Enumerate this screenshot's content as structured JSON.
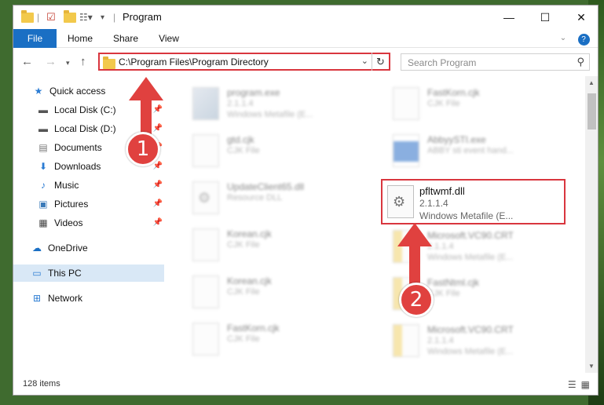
{
  "window": {
    "title": "Program",
    "controls": {
      "minimize": "—",
      "maximize": "☐",
      "close": "✕"
    }
  },
  "ribbon": {
    "tabs": [
      "File",
      "Home",
      "Share",
      "View"
    ],
    "help": "?"
  },
  "address": {
    "path": "C:\\Program Files\\Program Directory",
    "search_placeholder": "Search Program"
  },
  "sidebar": {
    "items": [
      {
        "label": "Quick access",
        "icon": "star-icon",
        "pinned": false
      },
      {
        "label": "Local Disk (C:)",
        "icon": "drive-icon",
        "pinned": true
      },
      {
        "label": "Local Disk (D:)",
        "icon": "drive-icon",
        "pinned": true
      },
      {
        "label": "Documents",
        "icon": "document-icon",
        "pinned": true
      },
      {
        "label": "Downloads",
        "icon": "download-icon",
        "pinned": true
      },
      {
        "label": "Music",
        "icon": "music-icon",
        "pinned": true
      },
      {
        "label": "Pictures",
        "icon": "pictures-icon",
        "pinned": true
      },
      {
        "label": "Videos",
        "icon": "videos-icon",
        "pinned": true
      },
      {
        "label": "OneDrive",
        "icon": "cloud-icon",
        "pinned": false
      },
      {
        "label": "This PC",
        "icon": "computer-icon",
        "pinned": false,
        "selected": true
      },
      {
        "label": "Network",
        "icon": "network-icon",
        "pinned": false
      }
    ]
  },
  "files": [
    {
      "name": "program.exe",
      "line2": "2.1.1.4",
      "line3": "Windows Metafile (E...",
      "icon": "exe"
    },
    {
      "name": "FastKorn.cjk",
      "line2": "CJK File",
      "line3": "",
      "icon": "blank"
    },
    {
      "name": "gtd.cjk",
      "line2": "CJK File",
      "line3": "",
      "icon": "blank"
    },
    {
      "name": "AbbyySTI.exe",
      "line2": "ABBY sti event hand...",
      "line3": "",
      "icon": "blue"
    },
    {
      "name": "UpdateClient65.dll",
      "line2": "Resource DLL",
      "line3": "",
      "icon": "gear"
    },
    {
      "name": "Korean.cjk",
      "line2": "CJK File",
      "line3": "",
      "icon": "blank"
    },
    {
      "name": "Microsoft.VC90.CRT",
      "line2": "2.1.1.4",
      "line3": "Windows Metafile (E...",
      "icon": "yellow"
    },
    {
      "name": "Korean.cjk",
      "line2": "CJK File",
      "line3": "",
      "icon": "blank"
    },
    {
      "name": "FastNtml.cjk",
      "line2": "CJK File",
      "line3": "",
      "icon": "yellow"
    },
    {
      "name": "FastKorn.cjk",
      "line2": "CJK File",
      "line3": "",
      "icon": "blank"
    },
    {
      "name": "Microsoft.VC90.CRT",
      "line2": "2.1.1.4",
      "line3": "Windows Metafile (E...",
      "icon": "yellow"
    }
  ],
  "highlighted_file": {
    "name": "pfltwmf.dll",
    "version": "2.1.1.4",
    "type": "Windows Metafile (E..."
  },
  "status": {
    "item_count": "128 items"
  },
  "annotations": {
    "step1": "1",
    "step2": "2",
    "color": "#e0413f"
  }
}
